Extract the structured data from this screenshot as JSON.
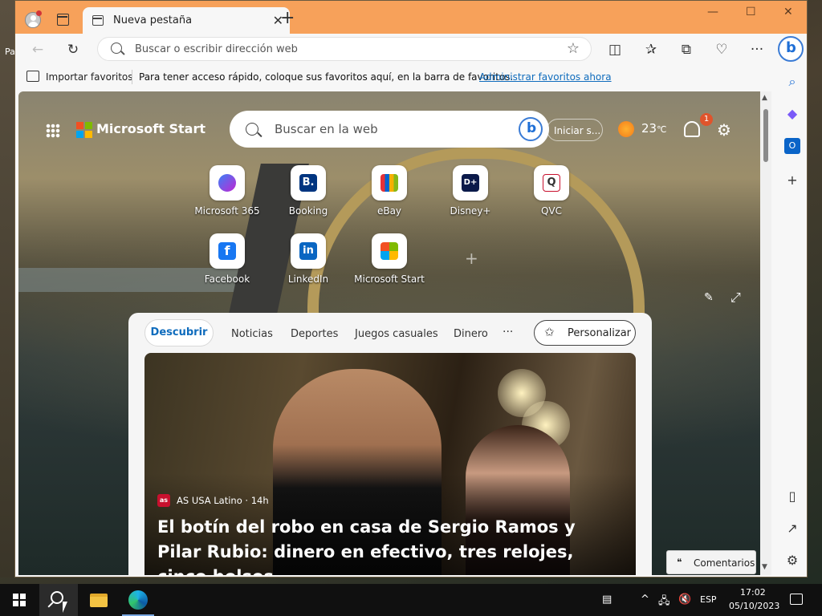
{
  "desktop": {
    "partial_label": "Pa"
  },
  "window": {
    "tab_title": "Nueva pestaña",
    "new_tab_symbol": "+",
    "close_tab_symbol": "✕",
    "controls": {
      "minimize": "—",
      "maximize": "☐",
      "close": "✕"
    }
  },
  "toolbar": {
    "address_placeholder": "Buscar o escribir dirección web",
    "icons": [
      "back-icon",
      "refresh-icon",
      "split-screen-icon",
      "favorites-icon",
      "collections-icon",
      "browser-essentials-icon",
      "more-icon",
      "bing-chat-icon"
    ]
  },
  "favorites_bar": {
    "import_label": "Importar favoritos",
    "info_text": "Para tener acceso rápido, coloque sus favoritos aquí, en la barra de favoritos.",
    "manage_link": "Administrar favoritos ahora"
  },
  "ms_start": {
    "brand": "Microsoft Start",
    "search_placeholder": "Buscar en la web",
    "signin": "Iniciar s...",
    "weather_temp": "23",
    "weather_unit": "℃",
    "notifications_count": "1"
  },
  "quick_links": [
    {
      "label": "Microsoft 365"
    },
    {
      "label": "Booking",
      "glyph": "B."
    },
    {
      "label": "eBay"
    },
    {
      "label": "Disney+",
      "glyph": "D+"
    },
    {
      "label": "QVC",
      "glyph": "Q"
    },
    {
      "label": "Facebook",
      "glyph": "f"
    },
    {
      "label": "LinkedIn",
      "glyph": "in"
    },
    {
      "label": "Microsoft Start"
    }
  ],
  "feed": {
    "tabs": [
      "Descubrir",
      "Noticias",
      "Deportes",
      "Juegos casuales",
      "Dinero"
    ],
    "more": "···",
    "personalize": "Personalizar",
    "article": {
      "source_badge": "as",
      "source": "AS USA Latino · 14h",
      "headline": "El botín del robo en casa de Sergio Ramos y Pilar Rubio: dinero en efectivo, tres relojes, cinco bolsos..."
    },
    "comments": "Comentarios"
  },
  "sidebar_icons": [
    "search-icon",
    "copilot-icon",
    "outlook-icon",
    "add-icon",
    "sidebar-toggle-icon",
    "open-external-icon",
    "settings-icon"
  ],
  "taskbar": {
    "language": "ESP",
    "time": "17:02",
    "date": "05/10/2023"
  },
  "colors": {
    "title_bar": "#f7a15a",
    "accent": "#0f6cbd",
    "taskbar": "#101010"
  }
}
